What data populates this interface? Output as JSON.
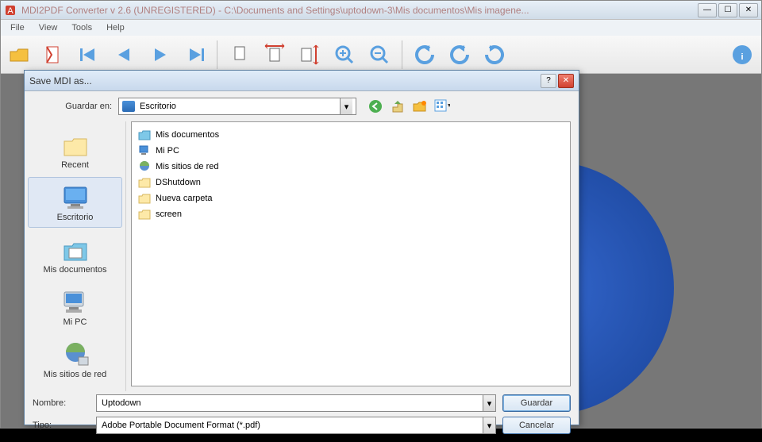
{
  "main": {
    "title": "MDI2PDF Converter v 2.6   (UNREGISTERED)  -  C:\\Documents and Settings\\uptodown-3\\Mis documentos\\Mis imagene...",
    "menu": [
      "File",
      "View",
      "Tools",
      "Help"
    ]
  },
  "dialog": {
    "title": "Save MDI as...",
    "save_in_label": "Guardar en:",
    "location": "Escritorio",
    "places": [
      {
        "label": "Recent",
        "name": "recent"
      },
      {
        "label": "Escritorio",
        "name": "desktop",
        "selected": true
      },
      {
        "label": "Mis documentos",
        "name": "documents"
      },
      {
        "label": "Mi PC",
        "name": "mypc"
      },
      {
        "label": "Mis sitios de red",
        "name": "network"
      }
    ],
    "files": [
      {
        "label": "Mis documentos",
        "kind": "docs"
      },
      {
        "label": "Mi PC",
        "kind": "pc"
      },
      {
        "label": "Mis sitios de red",
        "kind": "net"
      },
      {
        "label": "DShutdown",
        "kind": "folder"
      },
      {
        "label": "Nueva carpeta",
        "kind": "folder"
      },
      {
        "label": "screen",
        "kind": "folder"
      }
    ],
    "name_label": "Nombre:",
    "name_value": "Uptodown",
    "type_label": "Tipo:",
    "type_value": "Adobe Portable Document Format (*.pdf)",
    "save_btn": "Guardar",
    "cancel_btn": "Cancelar"
  }
}
